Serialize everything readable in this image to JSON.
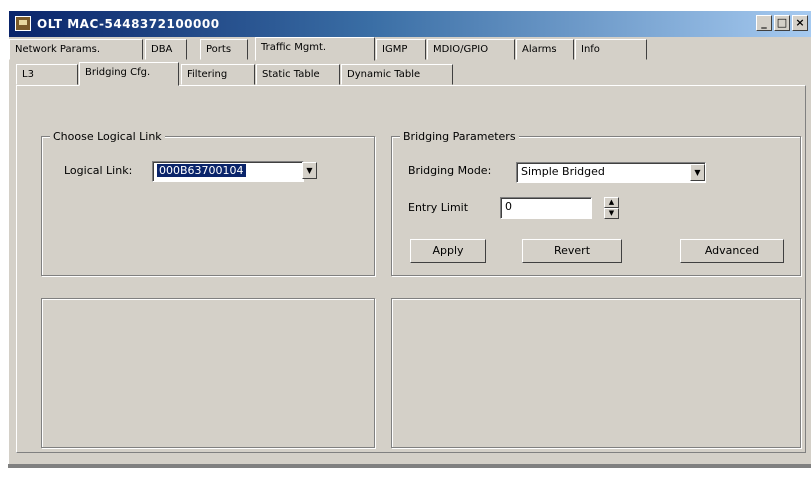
{
  "window": {
    "title": "OLT MAC-5448372100000",
    "controls": {
      "minimize": "_",
      "maximize": "□",
      "close": "×"
    }
  },
  "main_tabs": [
    {
      "label": "Network Params."
    },
    {
      "label": "DBA"
    },
    {
      "label": "Ports"
    },
    {
      "label": "Traffic Mgmt."
    },
    {
      "label": "IGMP"
    },
    {
      "label": "MDIO/GPIO"
    },
    {
      "label": "Alarms"
    },
    {
      "label": "Info"
    }
  ],
  "main_tabs_active": "Traffic Mgmt.",
  "sub_tabs": [
    {
      "label": "L3"
    },
    {
      "label": "Bridging Cfg."
    },
    {
      "label": "Filtering"
    },
    {
      "label": "Static Table"
    },
    {
      "label": "Dynamic Table"
    }
  ],
  "sub_tabs_active": "Bridging Cfg.",
  "logical_link_group": {
    "legend": "Choose Logical Link",
    "label": "Logical Link:",
    "value": "000B63700104"
  },
  "bridging_group": {
    "legend": "Bridging Parameters",
    "mode_label": "Bridging Mode:",
    "mode_value": "Simple Bridged",
    "entry_limit_label": "Entry Limit",
    "entry_limit_value": "0",
    "apply_label": "Apply",
    "revert_label": "Revert",
    "advanced_label": "Advanced"
  },
  "icons": {
    "app": "network-app-icon",
    "dropdown": "chevron-down-icon",
    "spin_up": "arrow-up-icon",
    "spin_down": "arrow-down-icon"
  },
  "colors": {
    "face": "#d4d0c8",
    "title_start": "#0a246a",
    "title_end": "#a6caf0",
    "selection": "#0a246a"
  }
}
